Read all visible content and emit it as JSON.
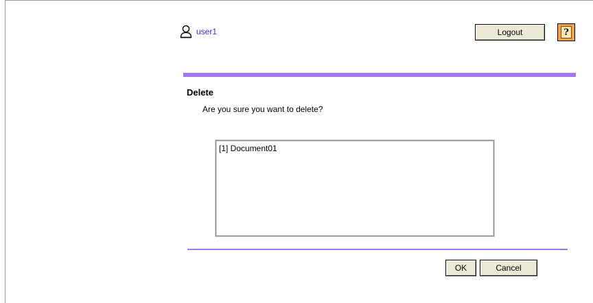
{
  "header": {
    "user_icon": "user-icon",
    "user_name": "user1",
    "logout_label": "Logout",
    "help_icon": "help-icon",
    "help_glyph": "?"
  },
  "dialog": {
    "title": "Delete",
    "message": "Are you sure you want to delete?",
    "items": [
      {
        "label": "[1] Document01"
      }
    ]
  },
  "actions": {
    "ok_label": "OK",
    "cancel_label": "Cancel"
  },
  "colors": {
    "accent_rule": "#a377ee",
    "user_link": "#2f36d9",
    "button_face": "#ece8d6",
    "help_button": "#f2a33d"
  }
}
